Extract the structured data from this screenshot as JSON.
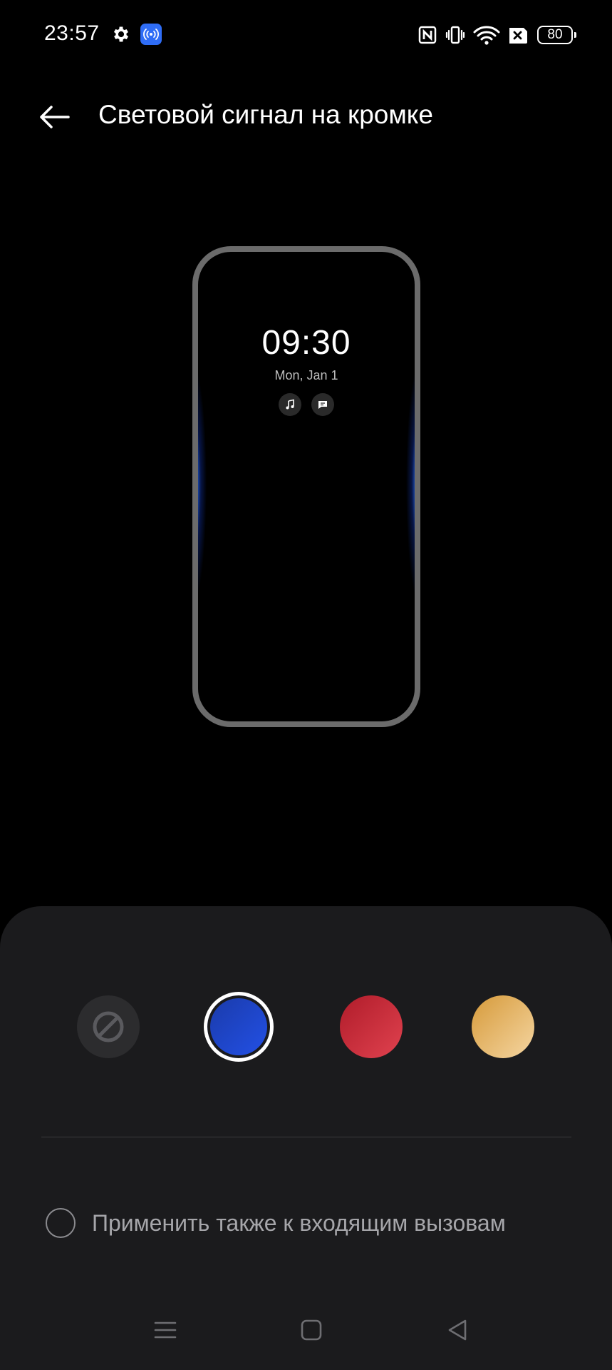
{
  "status_bar": {
    "time": "23:57",
    "battery": "80",
    "icons": [
      "gear-icon",
      "hotspot-icon",
      "nfc-icon",
      "vibrate-icon",
      "wifi-icon",
      "no-sim-icon",
      "battery-icon"
    ]
  },
  "header": {
    "title": "Световой сигнал на кромке",
    "back_icon": "arrow-left-icon"
  },
  "preview": {
    "clock": "09:30",
    "date": "Mon, Jan 1",
    "notification_icons": [
      "music-note-icon",
      "message-icon"
    ],
    "glow_color": "#2f6dff"
  },
  "colors": {
    "options": [
      {
        "name": "none",
        "color": "#2c2c2e",
        "selected": false
      },
      {
        "name": "blue",
        "color": "#2351e8",
        "selected": true
      },
      {
        "name": "red",
        "color": "#d63341",
        "selected": false
      },
      {
        "name": "gold",
        "color": "#ebbd72",
        "selected": false
      }
    ]
  },
  "options": {
    "incoming_calls_label": "Применить также к входящим вызовам",
    "incoming_calls_checked": false
  },
  "nav": {
    "icons": [
      "menu-icon",
      "home-icon",
      "back-triangle-icon"
    ]
  }
}
